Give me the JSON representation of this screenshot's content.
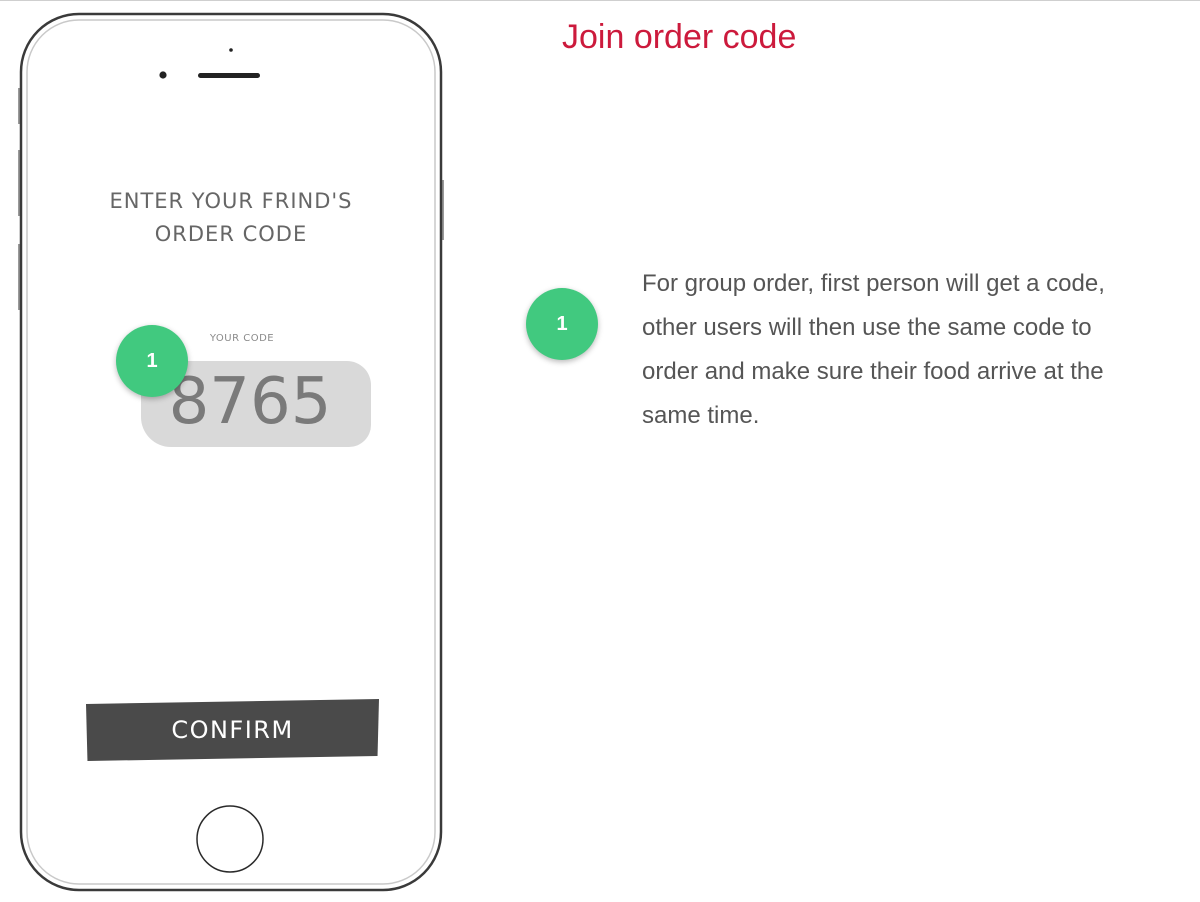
{
  "page": {
    "title": "Join order code",
    "title_color": "#cc1a3c"
  },
  "phone_screen": {
    "title_lines": [
      "ENTER YOUR FRIND'S",
      "ORDER CODE"
    ],
    "code_label": "YOUR CODE",
    "code_value": "8765",
    "confirm_label": "CONFIRM"
  },
  "annotations": [
    {
      "number": "1",
      "color": "#41c97f",
      "description": "For group order, first person will get a code, other users will then use the same code to order and make sure their food arrive at the same time."
    }
  ]
}
